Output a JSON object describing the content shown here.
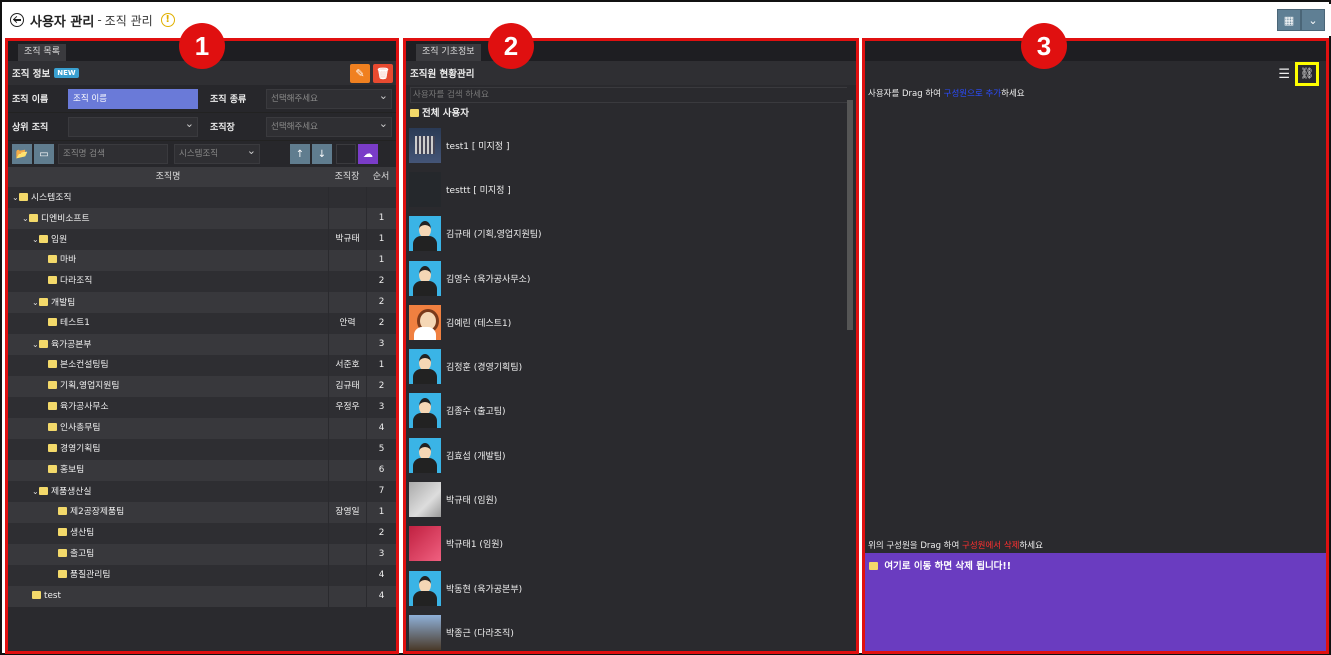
{
  "header": {
    "title": "사용자 관리",
    "sep": "-",
    "subtitle": "조직 관리"
  },
  "markers": [
    "1",
    "2",
    "3"
  ],
  "panel1": {
    "tab": "조직 목록",
    "section_title": "조직 정보",
    "badge": "NEW",
    "form": {
      "org_name_label": "조직 이름",
      "org_name_value": "조직 이름",
      "org_type_label": "조직 종류",
      "org_type_placeholder": "선택해주세요",
      "parent_label": "상위 조직",
      "parent_value": "",
      "head_label": "조직장",
      "head_placeholder": "선택해주세요"
    },
    "search_placeholder": "조직명 검색",
    "filter_value": "시스템조직",
    "columns": [
      "조직명",
      "조직장",
      "순서"
    ],
    "rows": [
      {
        "name": "시스템조직",
        "head": "",
        "order": "",
        "level": 0,
        "expanded": true
      },
      {
        "name": "디엔비소프트",
        "head": "",
        "order": "1",
        "level": 1,
        "expanded": true
      },
      {
        "name": "임원",
        "head": "박규태",
        "order": "1",
        "level": 2,
        "expanded": true
      },
      {
        "name": "마바",
        "head": "",
        "order": "1",
        "level": 3,
        "expanded": false
      },
      {
        "name": "다라조직",
        "head": "",
        "order": "2",
        "level": 3,
        "expanded": false
      },
      {
        "name": "개발팀",
        "head": "",
        "order": "2",
        "level": 2,
        "expanded": true
      },
      {
        "name": "테스트1",
        "head": "안력",
        "order": "2",
        "level": 3,
        "expanded": false
      },
      {
        "name": "육가공본부",
        "head": "",
        "order": "3",
        "level": 2,
        "expanded": true
      },
      {
        "name": "본소컨설팅팀",
        "head": "서준호",
        "order": "1",
        "level": 3,
        "expanded": false
      },
      {
        "name": "기획,영업지원팀",
        "head": "김규태",
        "order": "2",
        "level": 3,
        "expanded": false
      },
      {
        "name": "육가공사무소",
        "head": "우정우",
        "order": "3",
        "level": 3,
        "expanded": false
      },
      {
        "name": "인사총무팀",
        "head": "",
        "order": "4",
        "level": 3,
        "expanded": false
      },
      {
        "name": "경영기획팀",
        "head": "",
        "order": "5",
        "level": 3,
        "expanded": false
      },
      {
        "name": "홍보팀",
        "head": "",
        "order": "6",
        "level": 3,
        "expanded": false
      },
      {
        "name": "제품생산실",
        "head": "",
        "order": "7",
        "level": 2,
        "expanded": true
      },
      {
        "name": "제2공장제품팀",
        "head": "장영일",
        "order": "1",
        "level": 4,
        "expanded": false
      },
      {
        "name": "생산팀",
        "head": "",
        "order": "2",
        "level": 4,
        "expanded": false
      },
      {
        "name": "출고팀",
        "head": "",
        "order": "3",
        "level": 4,
        "expanded": false
      },
      {
        "name": "품질관리팀",
        "head": "",
        "order": "4",
        "level": 4,
        "expanded": false
      },
      {
        "name": "test",
        "head": "",
        "order": "4",
        "level": 2,
        "expanded": false
      }
    ]
  },
  "panel2": {
    "tab": "조직 기초정보",
    "section_title": "조직원 현황관리",
    "search_placeholder": "사용자를 검색 하세요",
    "all_users": "전체 사용자",
    "users": [
      {
        "name": "test1 [ 미지정 ]",
        "avatar": "photo1"
      },
      {
        "name": "testtt [ 미지정 ]",
        "avatar": "dark"
      },
      {
        "name": "김규태 (기획,영업지원팀)",
        "avatar": "person"
      },
      {
        "name": "김영수 (육가공사무소)",
        "avatar": "person"
      },
      {
        "name": "김예린 (테스트1)",
        "avatar": "girl"
      },
      {
        "name": "김정훈 (경영기획팀)",
        "avatar": "person"
      },
      {
        "name": "김종수 (출고팀)",
        "avatar": "person"
      },
      {
        "name": "김효섭 (개발팀)",
        "avatar": "person"
      },
      {
        "name": "박규태 (임원)",
        "avatar": "gray"
      },
      {
        "name": "박규태1 (임원)",
        "avatar": "red"
      },
      {
        "name": "박동현 (육가공본부)",
        "avatar": "person"
      },
      {
        "name": "박종근 (다라조직)",
        "avatar": "sky"
      }
    ]
  },
  "panel3": {
    "msg_top_a": "사용자를 Drag 하여",
    "msg_top_b": "구성원으로 추가",
    "msg_top_c": "하세요",
    "msg_bottom_a": "위의 구성원을 Drag 하여",
    "msg_bottom_b": "구성원에서 삭제",
    "msg_bottom_c": "하세요",
    "drop_text": "여기로 이동 하면 삭제 됩니다!!"
  }
}
